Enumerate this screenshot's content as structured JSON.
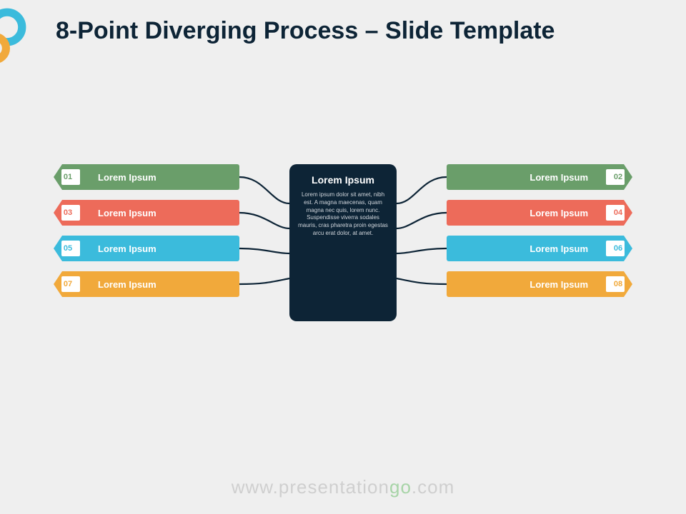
{
  "title": "8-Point Diverging Process – Slide Template",
  "center": {
    "title": "Lorem Ipsum",
    "desc": "Lorem ipsum dolor sit amet, nibh est. A magna maecenas, quam magna nec quis, lorem nunc. Suspendisse viverra sodales mauris, cras pharetra proin egestas arcu erat dolor, at amet."
  },
  "items": {
    "left": [
      {
        "num": "01",
        "label": "Lorem Ipsum",
        "colorClass": "c-green",
        "numClass": "n-green"
      },
      {
        "num": "03",
        "label": "Lorem Ipsum",
        "colorClass": "c-red",
        "numClass": "n-red"
      },
      {
        "num": "05",
        "label": "Lorem Ipsum",
        "colorClass": "c-blue",
        "numClass": "n-blue"
      },
      {
        "num": "07",
        "label": "Lorem Ipsum",
        "colorClass": "c-yel",
        "numClass": "n-yel"
      }
    ],
    "right": [
      {
        "num": "02",
        "label": "Lorem Ipsum",
        "colorClass": "c-green",
        "numClass": "n-green"
      },
      {
        "num": "04",
        "label": "Lorem Ipsum",
        "colorClass": "c-red",
        "numClass": "n-red"
      },
      {
        "num": "06",
        "label": "Lorem Ipsum",
        "colorClass": "c-blue",
        "numClass": "n-blue"
      },
      {
        "num": "08",
        "label": "Lorem Ipsum",
        "colorClass": "c-yel",
        "numClass": "n-yel"
      }
    ]
  },
  "footer": {
    "pre": "www.",
    "mid": "presentation",
    "go": "go",
    "post": ".com"
  }
}
